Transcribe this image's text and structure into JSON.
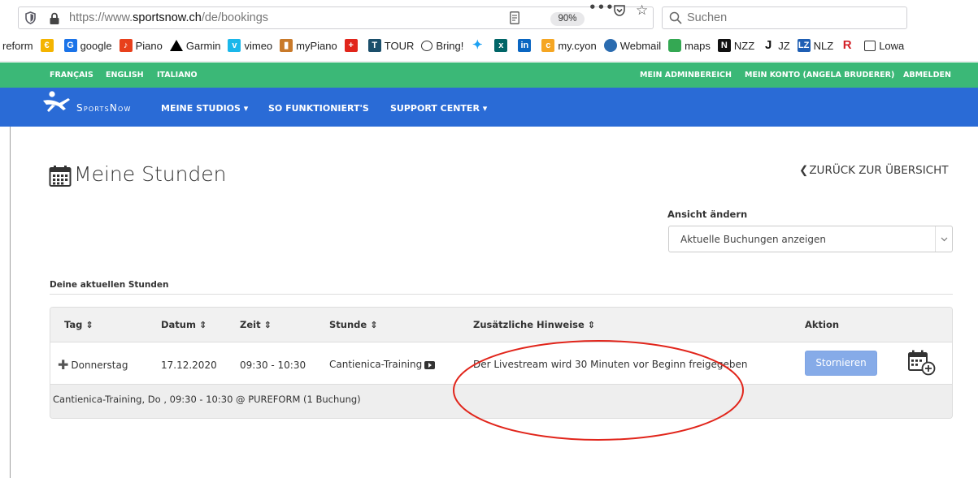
{
  "browser": {
    "url_prefix": "https://www.",
    "url_domain": "sportsnow.ch",
    "url_path": "/de/bookings",
    "zoom": "90%",
    "menu_dots": "•••",
    "search_placeholder": "Suchen",
    "bookmarks": [
      {
        "label": "reform",
        "icon": "none"
      },
      {
        "label": "",
        "icon": "coin-icon",
        "color": "#f4b400"
      },
      {
        "label": "google",
        "icon": "google-drive-icon",
        "color": "#1a73e8"
      },
      {
        "label": "Piano",
        "icon": "piano-icon",
        "color": "#e8401c"
      },
      {
        "label": "Garmin",
        "icon": "garmin-triangle-icon",
        "color": "#000000"
      },
      {
        "label": "vimeo",
        "icon": "vimeo-icon",
        "color": "#1ab7ea"
      },
      {
        "label": "myPiano",
        "icon": "piano-figure-icon",
        "color": "#c97a2a"
      },
      {
        "label": "",
        "icon": "swiss-cross-icon",
        "color": "#e1251b"
      },
      {
        "label": "TOUR",
        "icon": "tour-icon",
        "color": "#1b4f6b"
      },
      {
        "label": "Bring!",
        "icon": "globe-icon",
        "color": "#333333"
      },
      {
        "label": "",
        "icon": "twitter-icon",
        "color": "#1da1f2"
      },
      {
        "label": "",
        "icon": "xing-icon",
        "color": "#006567"
      },
      {
        "label": "",
        "icon": "linkedin-icon",
        "color": "#0a66c2"
      },
      {
        "label": "my.cyon",
        "icon": "cyon-icon",
        "color": "#f5a623"
      },
      {
        "label": "Webmail",
        "icon": "webmail-icon",
        "color": "#2b6cb0"
      },
      {
        "label": "maps",
        "icon": "maps-icon",
        "color": "#34a853"
      },
      {
        "label": "NZZ",
        "icon": "nzz-icon",
        "color": "#111111"
      },
      {
        "label": "JZ",
        "icon": "jz-icon",
        "color": "#111111"
      },
      {
        "label": "NLZ",
        "icon": "lz-icon",
        "color": "#1f5fb4"
      },
      {
        "label": "",
        "icon": "r-icon",
        "color": "#d31f26"
      },
      {
        "label": "Lowa",
        "icon": "folder-icon",
        "color": "#333333"
      }
    ]
  },
  "site": {
    "languages": [
      "FRANÇAIS",
      "ENGLISH",
      "ITALIANO"
    ],
    "account_links": [
      "MEIN ADMINBEREICH",
      "MEIN KONTO (ANGELA BRUDERER)",
      "ABMELDEN"
    ],
    "logo_text": "SportsNow",
    "nav": [
      "MEINE STUDIOS ▾",
      "SO FUNKTIONIERT'S",
      "SUPPORT CENTER ▾"
    ]
  },
  "page": {
    "title": "Meine Stunden",
    "back_link": "ZURÜCK ZUR ÜBERSICHT",
    "view_label": "Ansicht ändern",
    "view_selected": "Aktuelle Buchungen anzeigen",
    "section_label": "Deine aktuellen Stunden"
  },
  "table": {
    "headers": [
      "Tag",
      "Datum",
      "Zeit",
      "Stunde",
      "Zusätzliche Hinweise",
      "Aktion"
    ],
    "sortable": [
      true,
      true,
      true,
      true,
      true,
      false
    ],
    "sort_glyph": "⇕",
    "rows": [
      {
        "tag": "Donnerstag",
        "datum": "17.12.2020",
        "zeit": "09:30 - 10:30",
        "stunde": "Cantienica-Training",
        "hinweise": "Der Livestream wird 30 Minuten vor Beginn freigegeben",
        "action_label": "Stornieren"
      }
    ],
    "summary": "Cantienica-Training, Do , 09:30 - 10:30 @ PUREFORM (1 Buchung)"
  },
  "colors": {
    "lang_bar": "#3bb877",
    "nav_bar": "#2a6bd6",
    "cancel_button": "#86abe8",
    "annotation": "#e1251b"
  }
}
